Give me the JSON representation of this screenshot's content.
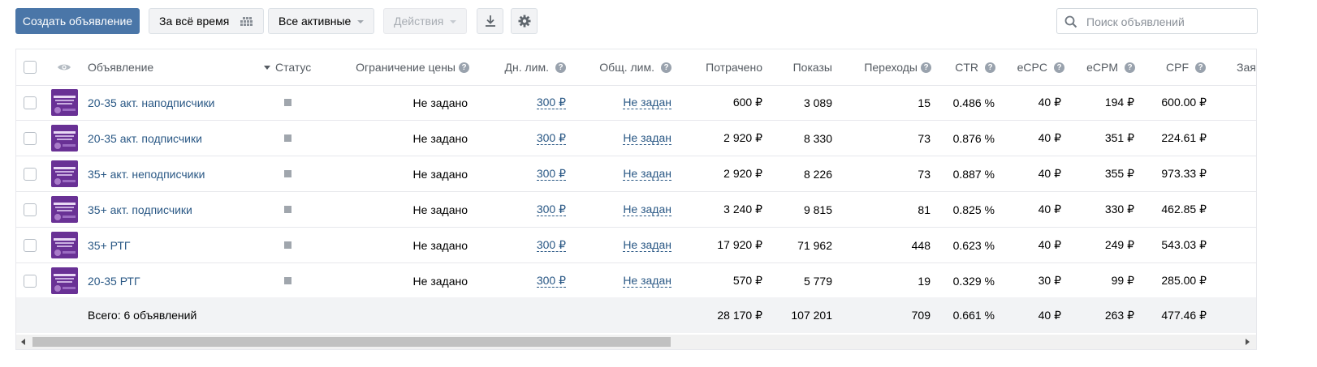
{
  "toolbar": {
    "create_label": "Создать объявление",
    "period_label": "За всё время",
    "filter_label": "Все активные",
    "actions_label": "Действия",
    "search_placeholder": "Поиск объявлений"
  },
  "table": {
    "columns": {
      "ad": "Объявление",
      "status": "Статус",
      "price_limit": "Ограничение цены",
      "day_limit": "Дн. лим.",
      "total_limit": "Общ. лим.",
      "spent": "Потрачено",
      "impressions": "Показы",
      "clicks": "Переходы",
      "ctr": "CTR",
      "ecpc": "eCPC",
      "ecpm": "eCPM",
      "cpf": "CPF",
      "next": "Зая"
    },
    "rows": [
      {
        "name": "20-35 акт. наподписчики",
        "price_limit": "Не задано",
        "day_limit": "300 ₽",
        "total_limit": "Не задан",
        "spent": "600 ₽",
        "impressions": "3 089",
        "clicks": "15",
        "ctr": "0.486 %",
        "ecpc": "40 ₽",
        "ecpm": "194 ₽",
        "cpf": "600.00 ₽"
      },
      {
        "name": "20-35 акт. подписчики",
        "price_limit": "Не задано",
        "day_limit": "300 ₽",
        "total_limit": "Не задан",
        "spent": "2 920 ₽",
        "impressions": "8 330",
        "clicks": "73",
        "ctr": "0.876 %",
        "ecpc": "40 ₽",
        "ecpm": "351 ₽",
        "cpf": "224.61 ₽"
      },
      {
        "name": "35+ акт. неподписчики",
        "price_limit": "Не задано",
        "day_limit": "300 ₽",
        "total_limit": "Не задан",
        "spent": "2 920 ₽",
        "impressions": "8 226",
        "clicks": "73",
        "ctr": "0.887 %",
        "ecpc": "40 ₽",
        "ecpm": "355 ₽",
        "cpf": "973.33 ₽"
      },
      {
        "name": "35+ акт. подписчики",
        "price_limit": "Не задано",
        "day_limit": "300 ₽",
        "total_limit": "Не задан",
        "spent": "3 240 ₽",
        "impressions": "9 815",
        "clicks": "81",
        "ctr": "0.825 %",
        "ecpc": "40 ₽",
        "ecpm": "330 ₽",
        "cpf": "462.85 ₽"
      },
      {
        "name": "35+ РТГ",
        "price_limit": "Не задано",
        "day_limit": "300 ₽",
        "total_limit": "Не задан",
        "spent": "17 920 ₽",
        "impressions": "71 962",
        "clicks": "448",
        "ctr": "0.623 %",
        "ecpc": "40 ₽",
        "ecpm": "249 ₽",
        "cpf": "543.03 ₽"
      },
      {
        "name": "20-35 РТГ",
        "price_limit": "Не задано",
        "day_limit": "300 ₽",
        "total_limit": "Не задан",
        "spent": "570 ₽",
        "impressions": "5 779",
        "clicks": "19",
        "ctr": "0.329 %",
        "ecpc": "30 ₽",
        "ecpm": "99 ₽",
        "cpf": "285.00 ₽"
      }
    ],
    "total": {
      "label": "Всего: 6 объявлений",
      "spent": "28 170 ₽",
      "impressions": "107 201",
      "clicks": "709",
      "ctr": "0.661 %",
      "ecpc": "40 ₽",
      "ecpm": "263 ₽",
      "cpf": "477.46 ₽"
    }
  },
  "colors": {
    "primary": "#4a76a8",
    "link": "#2a5885",
    "thumb": "#5b2a86"
  }
}
